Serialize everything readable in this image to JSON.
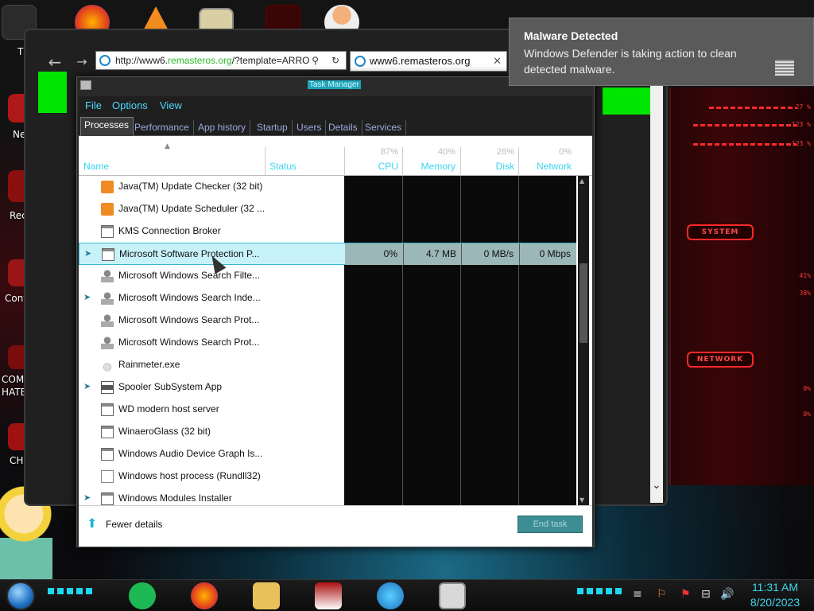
{
  "browser": {
    "address_prefix": "http://www6.",
    "address_highlight": "remasteros.org",
    "address_suffix": "/?template=ARRO",
    "tab_title": "www6.remasteros.org"
  },
  "desktop": {
    "labels": [
      "T",
      "Ne",
      "Rec",
      "Cont",
      "COMM",
      "HATE",
      "CH"
    ]
  },
  "task_manager": {
    "title": "Task Manager",
    "menu": [
      "File",
      "Options",
      "View"
    ],
    "tabs": [
      "Processes",
      "Performance",
      "App history",
      "Startup",
      "Users",
      "Details",
      "Services"
    ],
    "active_tab": "Processes",
    "columns": {
      "name": "Name",
      "status": "Status",
      "cpu": "CPU",
      "cpu_pct": "87%",
      "memory": "Memory",
      "memory_pct": "40%",
      "disk": "Disk",
      "disk_pct": "26%",
      "network": "Network",
      "network_pct": "0%"
    },
    "rows": [
      {
        "name": "Java(TM) Update Checker (32 bit)",
        "expandable": false,
        "icon": "java-icon"
      },
      {
        "name": "Java(TM) Update Scheduler (32 ...",
        "expandable": false,
        "icon": "java-icon"
      },
      {
        "name": "KMS Connection Broker",
        "expandable": false,
        "icon": "app-window-icon"
      },
      {
        "name": "Microsoft Software Protection P...",
        "expandable": true,
        "icon": "app-window-icon",
        "selected": true,
        "cpu": "0%",
        "memory": "4.7 MB",
        "disk": "0 MB/s",
        "network": "0 Mbps"
      },
      {
        "name": "Microsoft Windows Search Filte...",
        "expandable": false,
        "icon": "search-user-icon"
      },
      {
        "name": "Microsoft Windows Search Inde...",
        "expandable": true,
        "icon": "search-user-icon"
      },
      {
        "name": "Microsoft Windows Search Prot...",
        "expandable": false,
        "icon": "search-user-icon"
      },
      {
        "name": "Microsoft Windows Search Prot...",
        "expandable": false,
        "icon": "search-user-icon"
      },
      {
        "name": "Rainmeter.exe",
        "expandable": false,
        "icon": "droplet-icon"
      },
      {
        "name": "Spooler SubSystem App",
        "expandable": true,
        "icon": "printer-icon"
      },
      {
        "name": "WD modern host server",
        "expandable": false,
        "icon": "app-window-icon"
      },
      {
        "name": "WinaeroGlass (32 bit)",
        "expandable": false,
        "icon": "app-window-icon"
      },
      {
        "name": "Windows Audio Device Graph Is...",
        "expandable": false,
        "icon": "app-window-icon"
      },
      {
        "name": "Windows host process (Rundll32)",
        "expandable": false,
        "icon": "document-icon"
      },
      {
        "name": "Windows Modules Installer",
        "expandable": true,
        "icon": "app-window-icon"
      }
    ],
    "footer": {
      "fewer_details": "Fewer details",
      "end_task": "End task"
    }
  },
  "notification": {
    "title": "Malware Detected",
    "body": "Windows Defender is taking action to clean detected malware."
  },
  "widgets": {
    "cpu_pct_1": "27 %",
    "cpu_pct_2": "123 %",
    "cpu_pct_3": "123 %",
    "system_label": "SYSTEM",
    "sys_pct_1": "41%",
    "sys_pct_2": "38%",
    "network_label": "NETWORK",
    "net_pct_1": "0%",
    "net_pct_2": "0%"
  },
  "taskbar": {
    "time": "11:31 AM",
    "date": "8/20/2023"
  }
}
